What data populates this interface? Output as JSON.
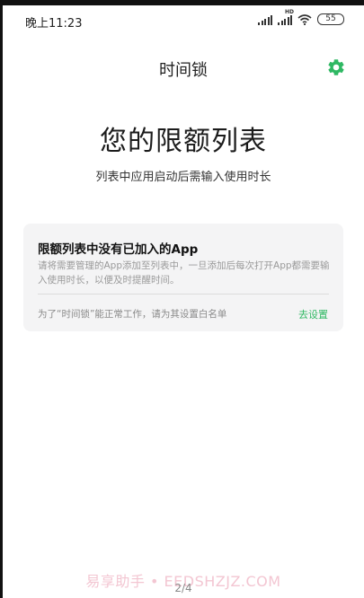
{
  "status_bar": {
    "time": "晚上11:23",
    "hd_label": "HD",
    "battery": "55",
    "icons": [
      "signal-icon",
      "signal-hd-icon",
      "wifi-icon",
      "battery-icon"
    ]
  },
  "header": {
    "title": "时间锁",
    "settings_icon": "gear-icon"
  },
  "hero": {
    "title": "您的限额列表",
    "subtitle": "列表中应用启动后需输入使用时长"
  },
  "card": {
    "title": "限额列表中没有已加入的App",
    "description": "请将需要管理的App添加至列表中，一旦添加后每次打开App都需要输入使用时长，以便及时提醒时间。",
    "note": "为了“时间锁”能正常工作，请为其设置白名单",
    "action_label": "去设置"
  },
  "footer": {
    "watermark": "易享助手 • EEDSHZJZ.COM",
    "page_indicator": "2/4"
  },
  "colors": {
    "accent": "#2fb863",
    "card_bg": "#f4f4f5",
    "background": "#ffffff"
  }
}
